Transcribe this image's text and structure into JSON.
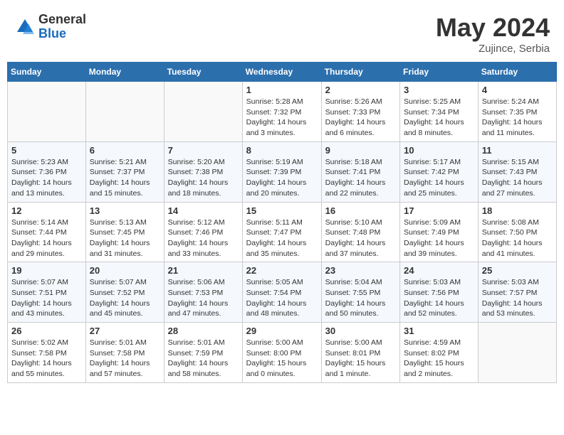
{
  "header": {
    "logo_general": "General",
    "logo_blue": "Blue",
    "month_year": "May 2024",
    "location": "Zujince, Serbia"
  },
  "weekdays": [
    "Sunday",
    "Monday",
    "Tuesday",
    "Wednesday",
    "Thursday",
    "Friday",
    "Saturday"
  ],
  "weeks": [
    [
      {
        "day": "",
        "info": ""
      },
      {
        "day": "",
        "info": ""
      },
      {
        "day": "",
        "info": ""
      },
      {
        "day": "1",
        "info": "Sunrise: 5:28 AM\nSunset: 7:32 PM\nDaylight: 14 hours\nand 3 minutes."
      },
      {
        "day": "2",
        "info": "Sunrise: 5:26 AM\nSunset: 7:33 PM\nDaylight: 14 hours\nand 6 minutes."
      },
      {
        "day": "3",
        "info": "Sunrise: 5:25 AM\nSunset: 7:34 PM\nDaylight: 14 hours\nand 8 minutes."
      },
      {
        "day": "4",
        "info": "Sunrise: 5:24 AM\nSunset: 7:35 PM\nDaylight: 14 hours\nand 11 minutes."
      }
    ],
    [
      {
        "day": "5",
        "info": "Sunrise: 5:23 AM\nSunset: 7:36 PM\nDaylight: 14 hours\nand 13 minutes."
      },
      {
        "day": "6",
        "info": "Sunrise: 5:21 AM\nSunset: 7:37 PM\nDaylight: 14 hours\nand 15 minutes."
      },
      {
        "day": "7",
        "info": "Sunrise: 5:20 AM\nSunset: 7:38 PM\nDaylight: 14 hours\nand 18 minutes."
      },
      {
        "day": "8",
        "info": "Sunrise: 5:19 AM\nSunset: 7:39 PM\nDaylight: 14 hours\nand 20 minutes."
      },
      {
        "day": "9",
        "info": "Sunrise: 5:18 AM\nSunset: 7:41 PM\nDaylight: 14 hours\nand 22 minutes."
      },
      {
        "day": "10",
        "info": "Sunrise: 5:17 AM\nSunset: 7:42 PM\nDaylight: 14 hours\nand 25 minutes."
      },
      {
        "day": "11",
        "info": "Sunrise: 5:15 AM\nSunset: 7:43 PM\nDaylight: 14 hours\nand 27 minutes."
      }
    ],
    [
      {
        "day": "12",
        "info": "Sunrise: 5:14 AM\nSunset: 7:44 PM\nDaylight: 14 hours\nand 29 minutes."
      },
      {
        "day": "13",
        "info": "Sunrise: 5:13 AM\nSunset: 7:45 PM\nDaylight: 14 hours\nand 31 minutes."
      },
      {
        "day": "14",
        "info": "Sunrise: 5:12 AM\nSunset: 7:46 PM\nDaylight: 14 hours\nand 33 minutes."
      },
      {
        "day": "15",
        "info": "Sunrise: 5:11 AM\nSunset: 7:47 PM\nDaylight: 14 hours\nand 35 minutes."
      },
      {
        "day": "16",
        "info": "Sunrise: 5:10 AM\nSunset: 7:48 PM\nDaylight: 14 hours\nand 37 minutes."
      },
      {
        "day": "17",
        "info": "Sunrise: 5:09 AM\nSunset: 7:49 PM\nDaylight: 14 hours\nand 39 minutes."
      },
      {
        "day": "18",
        "info": "Sunrise: 5:08 AM\nSunset: 7:50 PM\nDaylight: 14 hours\nand 41 minutes."
      }
    ],
    [
      {
        "day": "19",
        "info": "Sunrise: 5:07 AM\nSunset: 7:51 PM\nDaylight: 14 hours\nand 43 minutes."
      },
      {
        "day": "20",
        "info": "Sunrise: 5:07 AM\nSunset: 7:52 PM\nDaylight: 14 hours\nand 45 minutes."
      },
      {
        "day": "21",
        "info": "Sunrise: 5:06 AM\nSunset: 7:53 PM\nDaylight: 14 hours\nand 47 minutes."
      },
      {
        "day": "22",
        "info": "Sunrise: 5:05 AM\nSunset: 7:54 PM\nDaylight: 14 hours\nand 48 minutes."
      },
      {
        "day": "23",
        "info": "Sunrise: 5:04 AM\nSunset: 7:55 PM\nDaylight: 14 hours\nand 50 minutes."
      },
      {
        "day": "24",
        "info": "Sunrise: 5:03 AM\nSunset: 7:56 PM\nDaylight: 14 hours\nand 52 minutes."
      },
      {
        "day": "25",
        "info": "Sunrise: 5:03 AM\nSunset: 7:57 PM\nDaylight: 14 hours\nand 53 minutes."
      }
    ],
    [
      {
        "day": "26",
        "info": "Sunrise: 5:02 AM\nSunset: 7:58 PM\nDaylight: 14 hours\nand 55 minutes."
      },
      {
        "day": "27",
        "info": "Sunrise: 5:01 AM\nSunset: 7:58 PM\nDaylight: 14 hours\nand 57 minutes."
      },
      {
        "day": "28",
        "info": "Sunrise: 5:01 AM\nSunset: 7:59 PM\nDaylight: 14 hours\nand 58 minutes."
      },
      {
        "day": "29",
        "info": "Sunrise: 5:00 AM\nSunset: 8:00 PM\nDaylight: 15 hours\nand 0 minutes."
      },
      {
        "day": "30",
        "info": "Sunrise: 5:00 AM\nSunset: 8:01 PM\nDaylight: 15 hours\nand 1 minute."
      },
      {
        "day": "31",
        "info": "Sunrise: 4:59 AM\nSunset: 8:02 PM\nDaylight: 15 hours\nand 2 minutes."
      },
      {
        "day": "",
        "info": ""
      }
    ]
  ]
}
